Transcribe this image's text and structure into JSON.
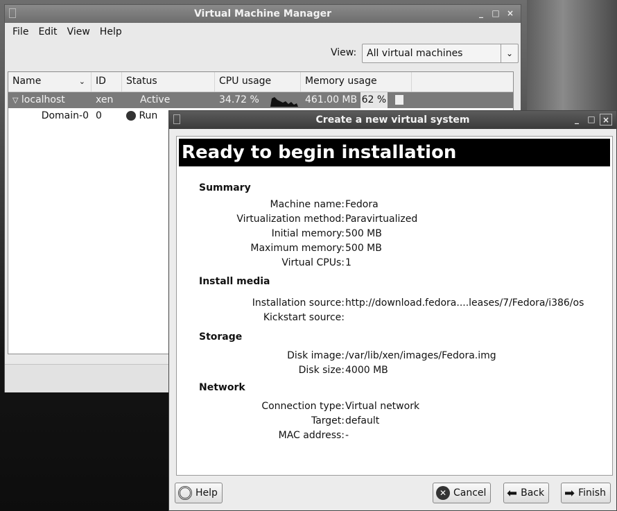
{
  "vmm": {
    "title": "Virtual Machine Manager",
    "menu": [
      "File",
      "Edit",
      "View",
      "Help"
    ],
    "view_label": "View:",
    "view_value": "All virtual machines",
    "columns": [
      "Name",
      "ID",
      "Status",
      "CPU usage",
      "Memory usage"
    ],
    "rows": [
      {
        "name": "localhost",
        "id": "xen",
        "status": "Active",
        "cpu": "34.72 %",
        "memory": "461.00 MB",
        "mem_pct": "62 %"
      },
      {
        "name": "Domain-0",
        "id": "0",
        "status": "Run",
        "cpu": "",
        "memory": "",
        "mem_pct": ""
      }
    ]
  },
  "dialog": {
    "title": "Create a new virtual system",
    "heading": "Ready to begin installation",
    "sections": {
      "summary": "Summary",
      "install_media": "Install media",
      "storage": "Storage",
      "network": "Network"
    },
    "summary": {
      "machine_name_label": "Machine name:",
      "machine_name": "Fedora",
      "virt_method_label": "Virtualization method:",
      "virt_method": "Paravirtualized",
      "initial_memory_label": "Initial memory:",
      "initial_memory": "500 MB",
      "max_memory_label": "Maximum memory:",
      "max_memory": "500 MB",
      "vcpus_label": "Virtual CPUs:",
      "vcpus": "1"
    },
    "install_media": {
      "source_label": "Installation source:",
      "source": "http://download.fedora....leases/7/Fedora/i386/os",
      "kickstart_label": "Kickstart source:",
      "kickstart": ""
    },
    "storage": {
      "disk_image_label": "Disk image:",
      "disk_image": "/var/lib/xen/images/Fedora.img",
      "disk_size_label": "Disk size:",
      "disk_size": "4000 MB"
    },
    "network": {
      "conn_type_label": "Connection type:",
      "conn_type": "Virtual network",
      "target_label": "Target:",
      "target": "default",
      "mac_label": "MAC address:",
      "mac": "-"
    },
    "buttons": {
      "help": "Help",
      "cancel": "Cancel",
      "back": "Back",
      "finish": "Finish"
    }
  }
}
